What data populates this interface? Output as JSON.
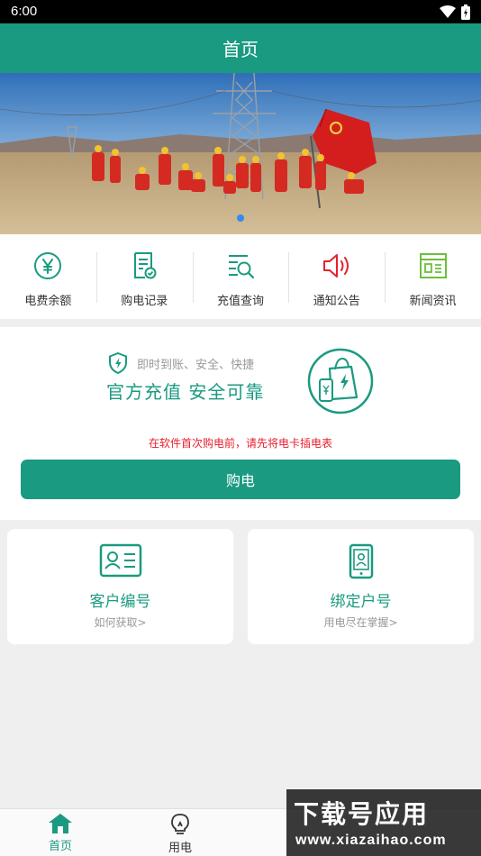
{
  "status_bar": {
    "time": "6:00"
  },
  "header": {
    "title": "首页"
  },
  "banner": {
    "slides": 1,
    "active_slide": 1
  },
  "quick_menu": [
    {
      "label": "电费余额",
      "icon": "yuan-circle-icon"
    },
    {
      "label": "购电记录",
      "icon": "receipt-icon"
    },
    {
      "label": "充值查询",
      "icon": "search-list-icon"
    },
    {
      "label": "通知公告",
      "icon": "speaker-icon"
    },
    {
      "label": "新闻资讯",
      "icon": "news-icon"
    }
  ],
  "recharge": {
    "subtitle": "即时到账、安全、快捷",
    "slogan": "官方充值  安全可靠",
    "notice": "在软件首次购电前，请先将电卡插电表",
    "buy_label": "购电"
  },
  "cards": [
    {
      "title": "客户编号",
      "subtitle": "如何获取>",
      "icon": "id-card-icon"
    },
    {
      "title": "绑定户号",
      "subtitle": "用电尽在掌握>",
      "icon": "phone-account-icon"
    }
  ],
  "bottom_nav": [
    {
      "label": "首页",
      "icon": "home-icon",
      "active": true
    },
    {
      "label": "用电",
      "icon": "lightbulb-icon",
      "active": false
    }
  ],
  "watermark": {
    "text": "下载号应用",
    "url": "www.xiazaihao.com"
  },
  "colors": {
    "primary": "#1a9a80",
    "notice": "#e5202e",
    "speaker": "#e5202e",
    "news": "#6bbf3a"
  }
}
